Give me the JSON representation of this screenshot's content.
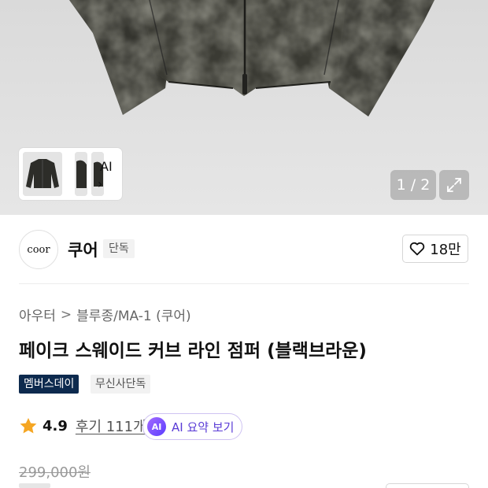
{
  "gallery": {
    "ai_thumb_label": "AI",
    "ai_thumb_chevron": "›",
    "pager_text": "1 / 2",
    "expand_icon": "expand-icon"
  },
  "brand": {
    "logo_text": "coor",
    "name": "쿠어",
    "badge": "단독",
    "likes": "18만",
    "like_icon": "heart-icon"
  },
  "breadcrumb": {
    "items": [
      "아우터",
      "블루종/MA-1 (쿠어)"
    ],
    "separator": ">"
  },
  "product": {
    "title": "페이크 스웨이드 커브 라인 점퍼 (블랙브라운)",
    "badges": [
      "멤버스데이",
      "무신사단독"
    ]
  },
  "rating": {
    "star_icon": "star-icon",
    "score": "4.9",
    "reviews": "후기 111개",
    "ai_badge": "AI",
    "ai_summary": "AI 요약 보기"
  },
  "price": {
    "original": "299,000원"
  },
  "colors": {
    "hero_bg": "#e2e2e2",
    "jacket": "#3a3a33",
    "member_badge": "#0d2a4e",
    "ai_accent": "#5a3cd6",
    "star": "#f5a623"
  }
}
